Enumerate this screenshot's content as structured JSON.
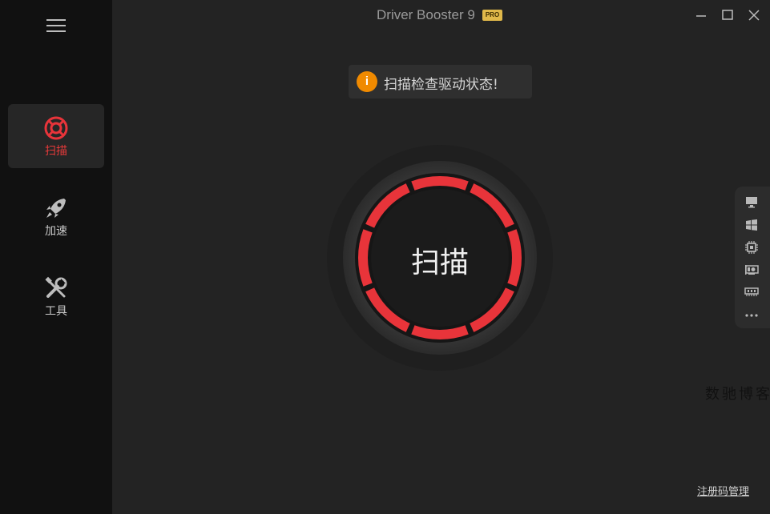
{
  "app": {
    "title": "Driver Booster 9",
    "badge": "PRO"
  },
  "window_controls": {
    "minimize_icon": "minimize-icon",
    "maximize_icon": "maximize-icon",
    "close_icon": "close-icon"
  },
  "sidebar": {
    "menu_icon": "hamburger-menu-icon",
    "items": [
      {
        "label": "扫描",
        "icon": "lifebuoy-icon",
        "active": true
      },
      {
        "label": "加速",
        "icon": "rocket-icon",
        "active": false
      },
      {
        "label": "工具",
        "icon": "tools-icon",
        "active": false
      }
    ]
  },
  "banner": {
    "icon": "info-icon",
    "icon_glyph": "i",
    "text": "扫描检查驱动状态!"
  },
  "scan_button": {
    "label": "扫描"
  },
  "side_panel": {
    "icons": [
      "monitor-icon",
      "windows-icon",
      "cpu-icon",
      "graphics-card-icon",
      "memory-icon",
      "more-icon"
    ]
  },
  "watermark": "数驰博客",
  "footer": {
    "register_link": "注册码管理"
  },
  "colors": {
    "accent": "#e8343a",
    "badge": "#e0b84a",
    "info": "#f08a00",
    "sidebar_bg": "#111111",
    "main_bg": "#232323"
  }
}
